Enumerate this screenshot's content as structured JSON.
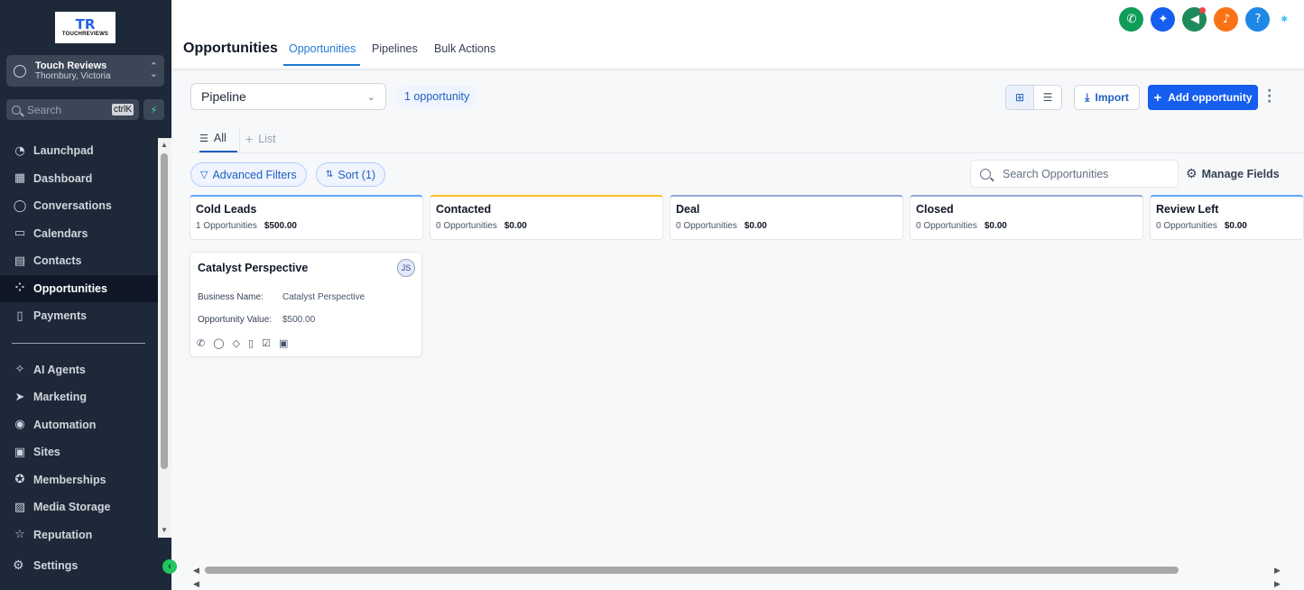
{
  "sidebar": {
    "logo": {
      "mark": "TR",
      "name": "TOUCHREVIEWS"
    },
    "account": {
      "name": "Touch Reviews",
      "location": "Thornbury, Victoria"
    },
    "search": {
      "placeholder": "Search",
      "shortcut": "ctrlK"
    },
    "items": [
      {
        "label": "Launchpad",
        "icon": "rocket-icon",
        "glyph": "◔"
      },
      {
        "label": "Dashboard",
        "icon": "dashboard-icon",
        "glyph": "▦"
      },
      {
        "label": "Conversations",
        "icon": "chat-icon",
        "glyph": "◯"
      },
      {
        "label": "Calendars",
        "icon": "calendar-icon",
        "glyph": "▭"
      },
      {
        "label": "Contacts",
        "icon": "contacts-icon",
        "glyph": "▤"
      },
      {
        "label": "Opportunities",
        "icon": "opportunities-icon",
        "glyph": "⁘",
        "active": true
      },
      {
        "label": "Payments",
        "icon": "payments-icon",
        "glyph": "▯"
      }
    ],
    "items2": [
      {
        "label": "AI Agents",
        "icon": "ai-agents-icon",
        "glyph": "✧"
      },
      {
        "label": "Marketing",
        "icon": "marketing-icon",
        "glyph": "➤"
      },
      {
        "label": "Automation",
        "icon": "automation-icon",
        "glyph": "◉"
      },
      {
        "label": "Sites",
        "icon": "sites-icon",
        "glyph": "▣"
      },
      {
        "label": "Memberships",
        "icon": "memberships-icon",
        "glyph": "✪"
      },
      {
        "label": "Media Storage",
        "icon": "media-icon",
        "glyph": "▨"
      },
      {
        "label": "Reputation",
        "icon": "reputation-icon",
        "glyph": "☆"
      }
    ],
    "settings": "Settings"
  },
  "header": {
    "title": "Opportunities",
    "tabs": [
      "Opportunities",
      "Pipelines",
      "Bulk Actions"
    ],
    "icons": [
      {
        "name": "phone-icon",
        "glyph": "✆",
        "color": "#0f9d58"
      },
      {
        "name": "magic-icon",
        "glyph": "✦",
        "color": "#155eef"
      },
      {
        "name": "megaphone-icon",
        "glyph": "◀",
        "color": "#1f8a5b",
        "dot": true
      },
      {
        "name": "bell-icon",
        "glyph": "♪",
        "color": "#f97316"
      },
      {
        "name": "help-icon",
        "glyph": "?",
        "color": "#1e88e5"
      }
    ]
  },
  "toolbar": {
    "pipeline": "Pipeline",
    "count": "1 opportunity",
    "import": "Import",
    "add": "Add opportunity"
  },
  "subtabs": {
    "all": "All",
    "list": "List"
  },
  "filters": {
    "advanced": "Advanced Filters",
    "sort": "Sort (1)",
    "search_placeholder": "Search Opportunities",
    "manage": "Manage Fields"
  },
  "columns": [
    {
      "name": "Cold Leads",
      "count": "1 Opportunities",
      "value": "$500.00",
      "color": "#60a5fa"
    },
    {
      "name": "Contacted",
      "count": "0 Opportunities",
      "value": "$0.00",
      "color": "#fbbf24"
    },
    {
      "name": "Deal",
      "count": "0 Opportunities",
      "value": "$0.00",
      "color": "#93a9d8"
    },
    {
      "name": "Closed",
      "count": "0 Opportunities",
      "value": "$0.00",
      "color": "#93a9d8"
    },
    {
      "name": "Review Left",
      "count": "0 Opportunities",
      "value": "$0.00",
      "color": "#60a5fa"
    }
  ],
  "card": {
    "title": "Catalyst Perspective",
    "avatar": "JS",
    "business_label": "Business Name:",
    "business_value": "Catalyst Perspective",
    "value_label": "Opportunity Value:",
    "value_value": "$500.00"
  }
}
